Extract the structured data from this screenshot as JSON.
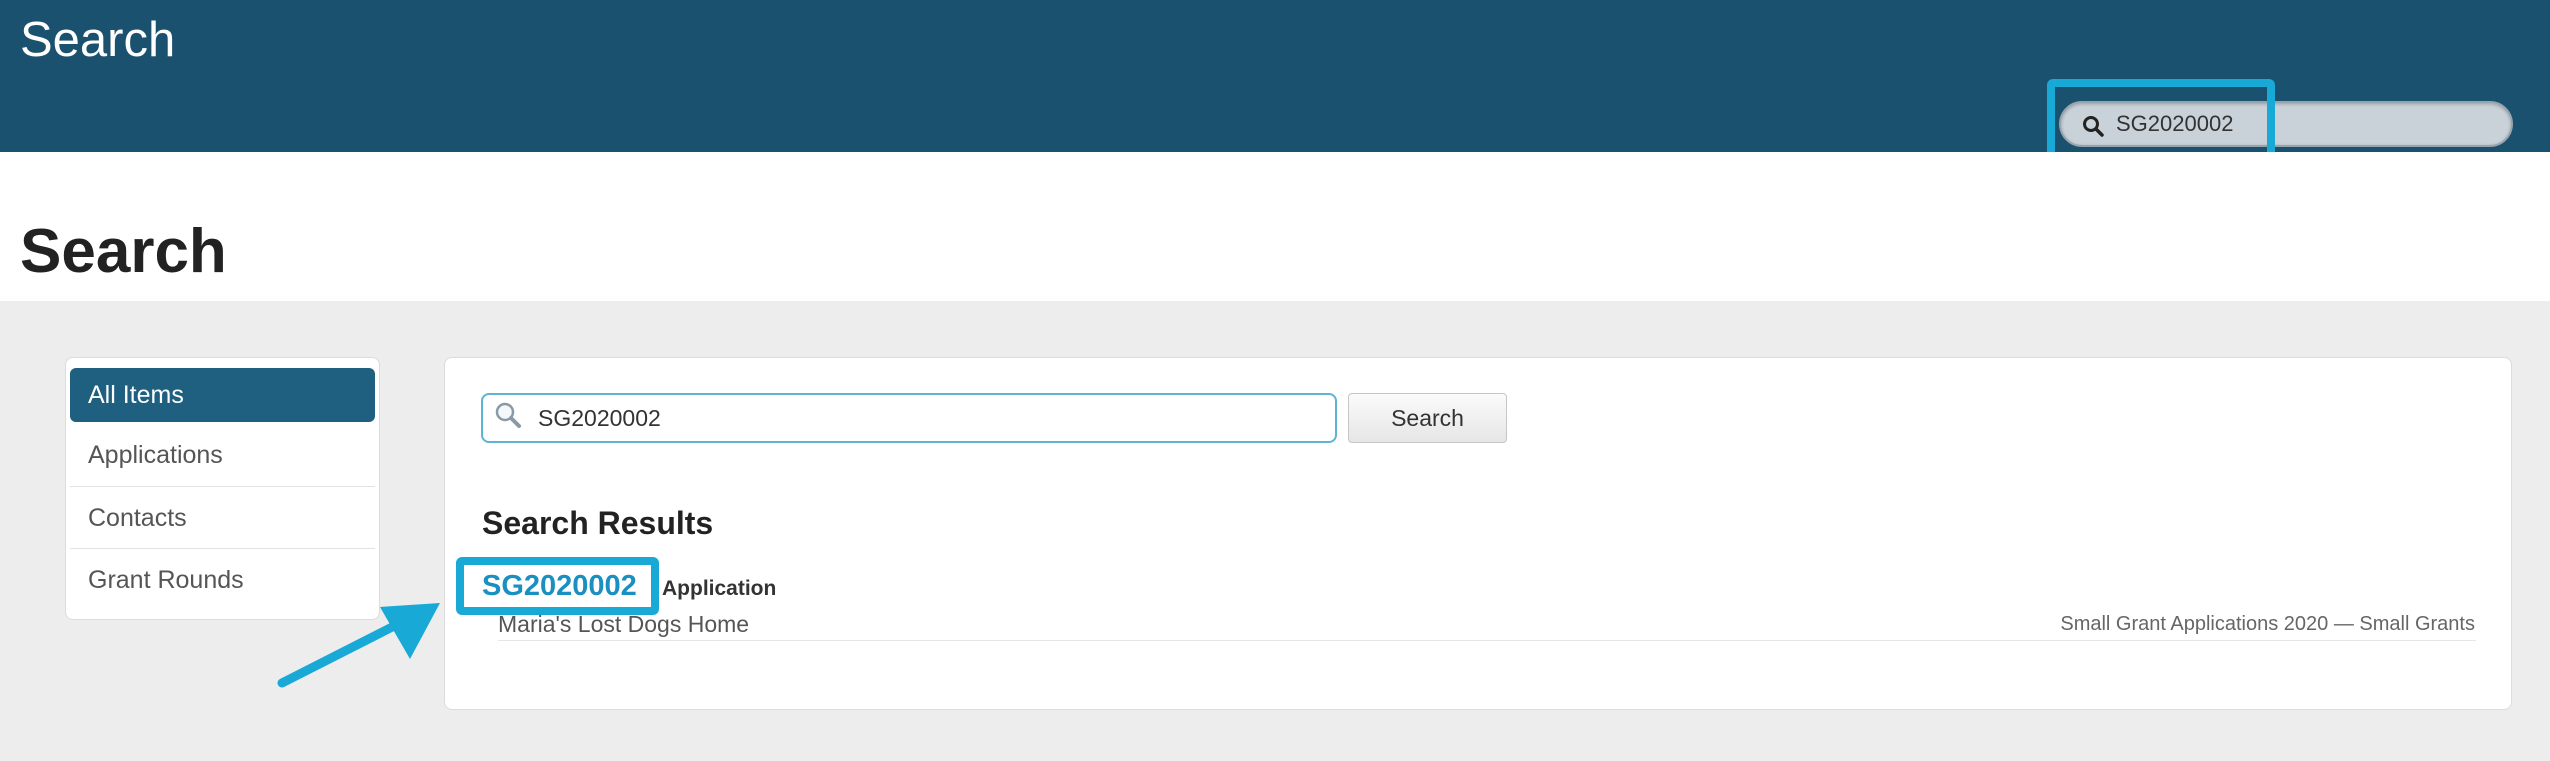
{
  "header": {
    "title": "Search",
    "search_value": "SG2020002"
  },
  "page": {
    "title": "Search"
  },
  "sidebar": {
    "items": [
      {
        "label": "All Items",
        "active": true
      },
      {
        "label": "Applications",
        "active": false
      },
      {
        "label": "Contacts",
        "active": false
      },
      {
        "label": "Grant Rounds",
        "active": false
      }
    ]
  },
  "main": {
    "search_value": "SG2020002",
    "search_button_label": "Search",
    "results_heading": "Search Results",
    "results": [
      {
        "id": "SG2020002",
        "type": "Application",
        "subtitle": "Maria's Lost Dogs Home",
        "meta": "Small Grant Applications 2020 — Small Grants"
      }
    ]
  },
  "icons": {
    "header_search": "search-icon",
    "main_search": "magnifier-icon",
    "annotation": "arrow-icon"
  },
  "colors": {
    "header_bg": "#1a516e",
    "active_nav": "#1f5f80",
    "highlight": "#18a9d6",
    "link": "#1a8fc2"
  }
}
